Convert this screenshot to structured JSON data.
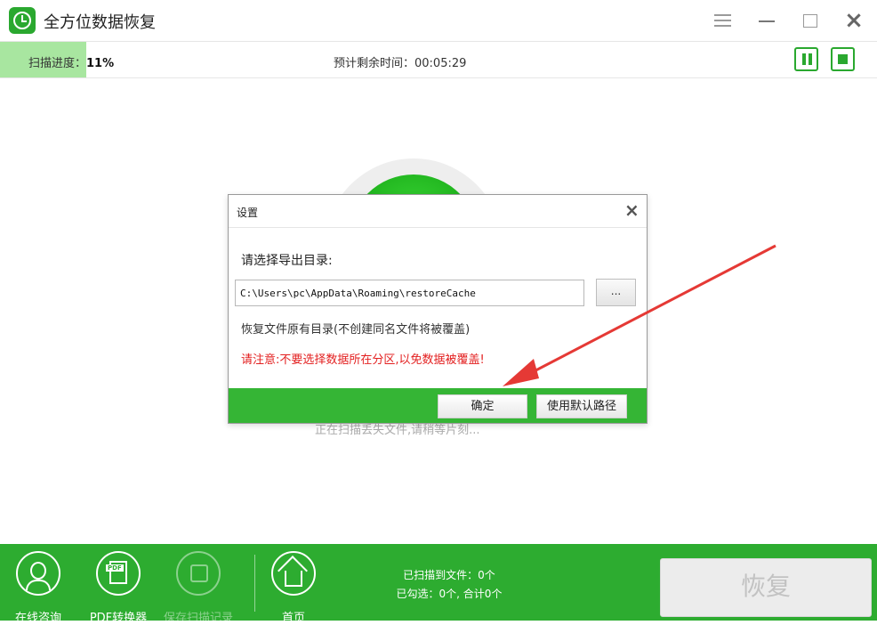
{
  "window": {
    "title": "全方位数据恢复"
  },
  "scan": {
    "progress_label": "扫描进度：",
    "progress_value": "11%",
    "progress_fraction": 0.11,
    "remaining_text": "预计剩余时间：00:05:29",
    "status_text": "正在扫描丢失文件,请稍等片刻..."
  },
  "dialog": {
    "title": "设置",
    "prompt": "请选择导出目录:",
    "path_value": "C:\\Users\\pc\\AppData\\Roaming\\restoreCache",
    "browse_label": "...",
    "note": "恢复文件原有目录(不创建同名文件将被覆盖)",
    "warning": "请注意:不要选择数据所在分区,以免数据被覆盖!",
    "ok_label": "确定",
    "default_label": "使用默认路径",
    "warning_color": "#e32020"
  },
  "bottom": {
    "tools": [
      {
        "label": "在线咨询",
        "icon": "headset-icon"
      },
      {
        "label": "PDF转换器",
        "icon": "pdf-icon"
      },
      {
        "label": "保存扫描记录",
        "icon": "save-record-icon"
      },
      {
        "label": "首页",
        "icon": "home-icon"
      }
    ],
    "scanned_files": "已扫描到文件：0个",
    "selected": "已勾选：0个, 合计0个",
    "restore_label": "恢复"
  },
  "colors": {
    "brand_green": "#2dac30",
    "progress_fill": "#a8e6a0",
    "annotation_arrow": "#e53935"
  }
}
